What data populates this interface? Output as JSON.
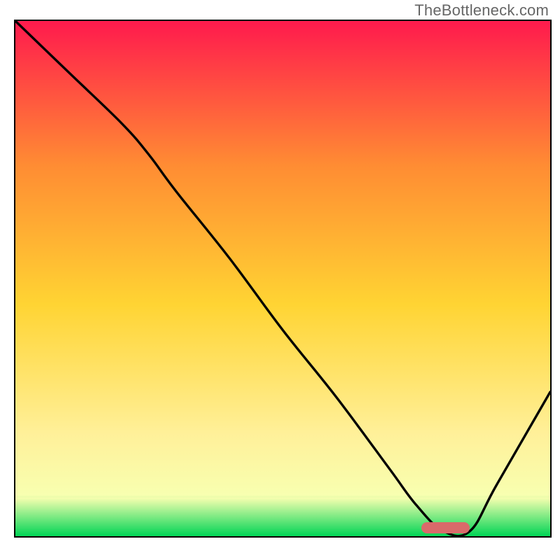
{
  "watermark": "TheBottleneck.com",
  "chart_data": {
    "type": "line",
    "title": "",
    "xlabel": "",
    "ylabel": "",
    "xlim": [
      0,
      100
    ],
    "ylim": [
      0,
      100
    ],
    "grid": false,
    "legend": "none",
    "background_gradient": {
      "top_color": "#ff1a4d",
      "mid_color_upper": "#ff8c33",
      "mid_color": "#ffd433",
      "mid_color_lower": "#fff099",
      "bottom_band_start": "#f8ffb0",
      "bottom_color": "#00d455"
    },
    "green_band": {
      "from_pct": 92.5,
      "to_pct": 100
    },
    "series": [
      {
        "name": "bottleneck-curve",
        "x": [
          0,
          10,
          20,
          25,
          30,
          40,
          50,
          60,
          70,
          75,
          80,
          85,
          90,
          100
        ],
        "y": [
          100,
          90,
          80,
          74,
          67,
          54,
          40,
          27,
          13,
          6,
          1,
          1,
          10,
          28
        ]
      }
    ],
    "annotations": [
      {
        "name": "optimal-zone-marker",
        "shape": "rounded-rect",
        "color": "#d96a6a",
        "x_from": 76,
        "x_to": 85,
        "y": 1.5,
        "height": 2.2
      }
    ]
  }
}
